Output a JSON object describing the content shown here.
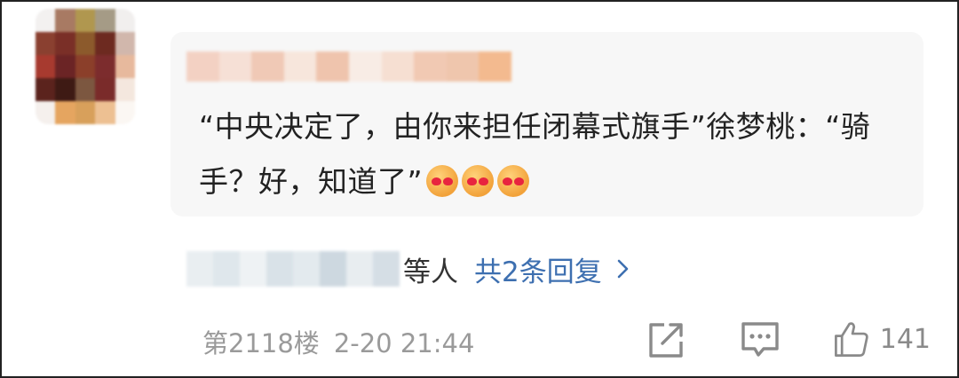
{
  "comment": {
    "text": "“中央决定了，由你来担任闭幕式旗手”徐梦桃：“骑手？好，知道了”",
    "emojis": [
      "laughing-crying-emoji",
      "laughing-crying-emoji",
      "laughing-crying-emoji"
    ]
  },
  "replies": {
    "suffix": "等人",
    "link": "共2条回复"
  },
  "footer": {
    "floor": "第2118楼",
    "datetime": "2-20 21:44",
    "like_count": "141"
  },
  "icons": {
    "share": "share-icon",
    "comment": "comment-icon",
    "like": "thumbs-up-icon",
    "chevron": "chevron-right-icon"
  },
  "colors": {
    "link": "#3d6fb0",
    "meta": "#9a9a9a",
    "bubble": "#f7f7f7"
  }
}
